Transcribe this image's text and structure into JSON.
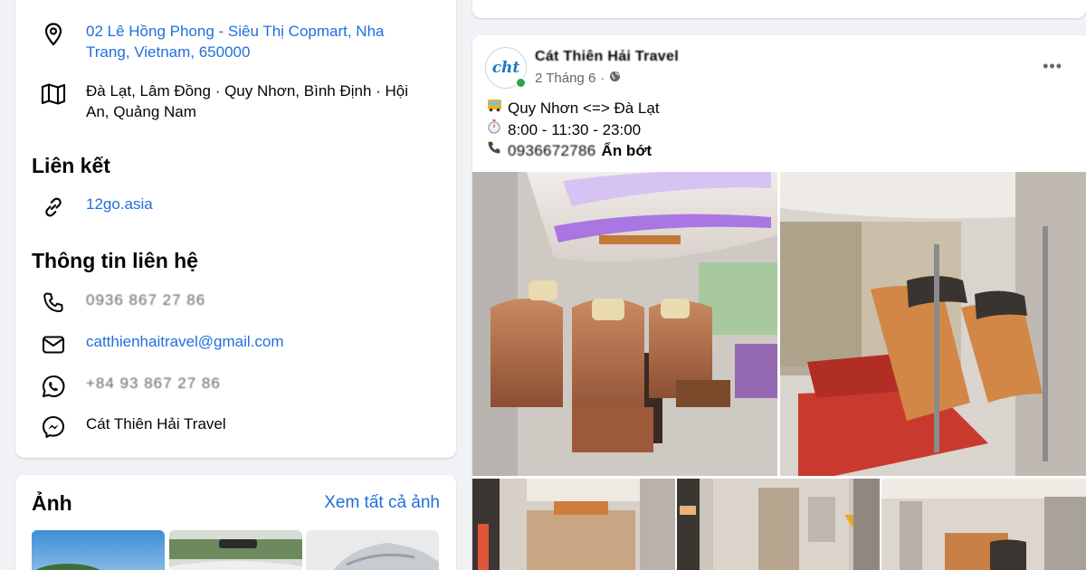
{
  "intro": {
    "address": "02 Lê Hồng Phong - Siêu Thị Copmart, Nha Trang, Vietnam, 650000",
    "address_line1": "02 Lê Hồng Phong - Siêu Thị Copmart, Nha",
    "address_line2": "Trang, Vietnam, 650000",
    "service_area_line1": "Đà Lạt, Lâm Đồng · Quy Nhơn, Bình Định · Hội",
    "service_area_line2": "An, Quảng Nam",
    "links_title": "Liên kết",
    "website": "12go.asia",
    "contact_title": "Thông tin liên hệ",
    "phone": "0936 867 27 86",
    "email": "catthienhaitravel@gmail.com",
    "whatsapp": "+84 93 867 27 86",
    "messenger": "Cát Thiên Hải Travel"
  },
  "photos": {
    "title": "Ảnh",
    "see_all": "Xem tất cả ảnh"
  },
  "post": {
    "page_name": "Cát Thiên Hải Travel",
    "date": "2 Tháng 6",
    "separator": "·",
    "more": "•••",
    "route": "Quy Nhơn <=> Đà Lạt",
    "times": "8:00 - 11:30 - 23:00",
    "phone": "0936672786",
    "see_more": "Ẩn bớt"
  },
  "colors": {
    "link": "#216fdb",
    "online": "#31a24c",
    "background": "#f0f2f5"
  },
  "icons": {
    "address": "location-pin-icon",
    "service_area": "map-icon",
    "website": "link-icon",
    "phone": "phone-icon",
    "email": "mail-icon",
    "whatsapp": "whatsapp-icon",
    "messenger": "messenger-icon",
    "privacy": "globe-icon",
    "bus": "bus-emoji",
    "clock": "stopwatch-emoji",
    "telephone": "telephone-emoji"
  }
}
